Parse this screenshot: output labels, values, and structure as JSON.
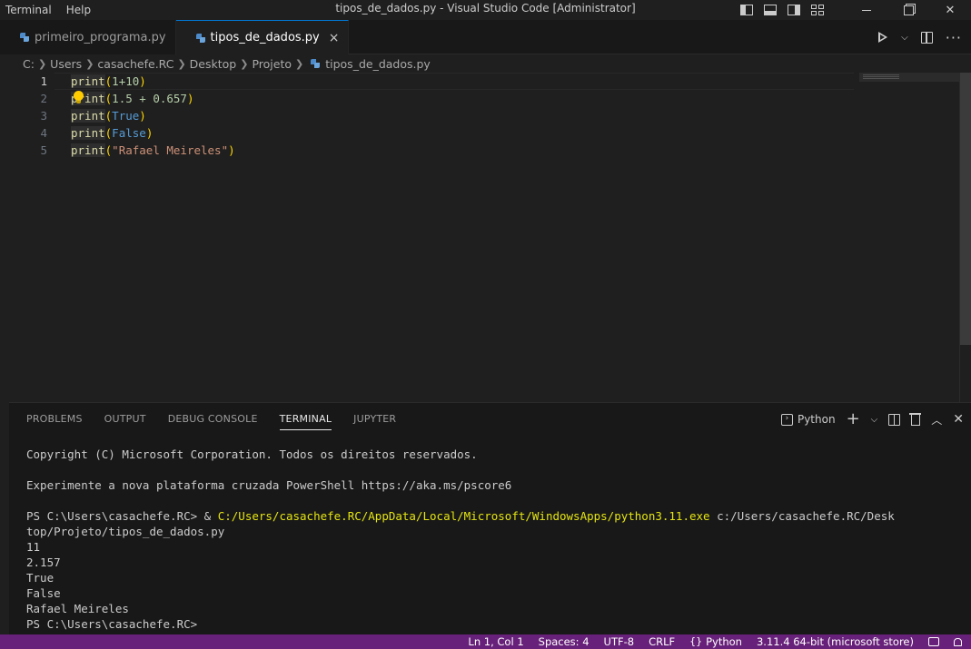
{
  "window": {
    "title": "tipos_de_dados.py - Visual Studio Code [Administrator]",
    "menu": [
      "Terminal",
      "Help"
    ]
  },
  "tabs": [
    {
      "label": "primeiro_programa.py",
      "icon": "python-icon",
      "active": false
    },
    {
      "label": "tipos_de_dados.py",
      "icon": "python-icon",
      "active": true,
      "close": "×"
    }
  ],
  "breadcrumb": [
    "C:",
    "Users",
    "casachefe.RC",
    "Desktop",
    "Projeto",
    "tipos_de_dados.py"
  ],
  "editor": {
    "line_numbers": [
      "1",
      "2",
      "3",
      "4",
      "5"
    ],
    "lines": [
      {
        "fn": "print",
        "open": "(",
        "args": [
          {
            "t": "1+10",
            "c": "num"
          }
        ],
        "close": ")"
      },
      {
        "fn": "print",
        "open": "(",
        "args": [
          {
            "t": "1.5 + 0.657",
            "c": "num"
          }
        ],
        "close": ")"
      },
      {
        "fn": "print",
        "open": "(",
        "args": [
          {
            "t": "True",
            "c": "kw"
          }
        ],
        "close": ")"
      },
      {
        "fn": "print",
        "open": "(",
        "args": [
          {
            "t": "False",
            "c": "kw"
          }
        ],
        "close": ")"
      },
      {
        "fn": "print",
        "open": "(",
        "args": [
          {
            "t": "\"Rafael Meireles\"",
            "c": "str"
          }
        ],
        "close": ")"
      }
    ]
  },
  "panel": {
    "tabs": [
      "PROBLEMS",
      "OUTPUT",
      "DEBUG CONSOLE",
      "TERMINAL",
      "JUPYTER"
    ],
    "active_tab": "TERMINAL",
    "terminal_profile": "Python",
    "terminal_lines": [
      {
        "text": "Copyright (C) Microsoft Corporation. Todos os direitos reservados."
      },
      {
        "text": ""
      },
      {
        "text": "Experimente a nova plataforma cruzada PowerShell https://aka.ms/pscore6"
      },
      {
        "text": ""
      },
      {
        "prefix": "PS C:\\Users\\casachefe.RC> & ",
        "highlight": "C:/Users/casachefe.RC/AppData/Local/Microsoft/WindowsApps/python3.11.exe",
        "suffix": " c:/Users/casachefe.RC/Desk"
      },
      {
        "text": "top/Projeto/tipos_de_dados.py"
      },
      {
        "text": "11"
      },
      {
        "text": "2.157"
      },
      {
        "text": "True"
      },
      {
        "text": "False"
      },
      {
        "text": "Rafael Meireles"
      },
      {
        "text": "PS C:\\Users\\casachefe.RC>"
      }
    ]
  },
  "statusbar": {
    "position": "Ln 1, Col 1",
    "spaces": "Spaces: 4",
    "encoding": "UTF-8",
    "eol": "CRLF",
    "language": "Python",
    "interpreter": "3.11.4 64-bit (microsoft store)",
    "color": "#68217a"
  }
}
